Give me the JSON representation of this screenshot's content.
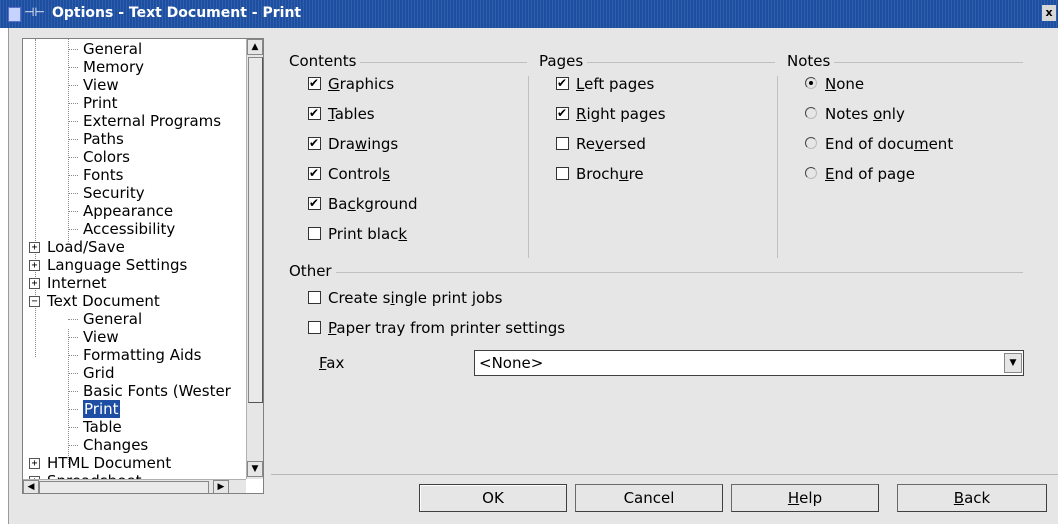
{
  "window": {
    "title": "Options - Text Document - Print",
    "title_icon": "window-pin-icon",
    "close": "x"
  },
  "tree": {
    "rows": [
      {
        "label": "General",
        "level": 2
      },
      {
        "label": "Memory",
        "level": 2
      },
      {
        "label": "View",
        "level": 2
      },
      {
        "label": "Print",
        "level": 2
      },
      {
        "label": "External Programs",
        "level": 2
      },
      {
        "label": "Paths",
        "level": 2
      },
      {
        "label": "Colors",
        "level": 2
      },
      {
        "label": "Fonts",
        "level": 2
      },
      {
        "label": "Security",
        "level": 2
      },
      {
        "label": "Appearance",
        "level": 2
      },
      {
        "label": "Accessibility",
        "level": 2
      },
      {
        "label": "Load/Save",
        "level": 1,
        "expander": "+"
      },
      {
        "label": "Language Settings",
        "level": 1,
        "expander": "+"
      },
      {
        "label": "Internet",
        "level": 1,
        "expander": "+"
      },
      {
        "label": "Text Document",
        "level": 1,
        "expander": "-"
      },
      {
        "label": "General",
        "level": 2
      },
      {
        "label": "View",
        "level": 2
      },
      {
        "label": "Formatting Aids",
        "level": 2
      },
      {
        "label": "Grid",
        "level": 2
      },
      {
        "label": "Basic Fonts (Wester",
        "level": 2
      },
      {
        "label": "Print",
        "level": 2,
        "selected": true
      },
      {
        "label": "Table",
        "level": 2
      },
      {
        "label": "Changes",
        "level": 2
      },
      {
        "label": "HTML Document",
        "level": 1,
        "expander": "+"
      },
      {
        "label": "Spreadsheet",
        "level": 1,
        "expander": "+"
      }
    ]
  },
  "contents": {
    "label": "Contents",
    "items": [
      {
        "pre": "",
        "key": "G",
        "post": "raphics",
        "checked": true
      },
      {
        "pre": "",
        "key": "T",
        "post": "ables",
        "checked": true
      },
      {
        "pre": "Dra",
        "key": "w",
        "post": "ings",
        "checked": true
      },
      {
        "pre": "Control",
        "key": "s",
        "post": "",
        "checked": true
      },
      {
        "pre": "Ba",
        "key": "c",
        "post": "kground",
        "checked": true
      },
      {
        "pre": "Print blac",
        "key": "k",
        "post": "",
        "checked": false
      }
    ]
  },
  "pages": {
    "label": "Pages",
    "items": [
      {
        "pre": "",
        "key": "L",
        "post": "eft pages",
        "checked": true
      },
      {
        "pre": "",
        "key": "R",
        "post": "ight pages",
        "checked": true
      },
      {
        "pre": "Re",
        "key": "v",
        "post": "ersed",
        "checked": false
      },
      {
        "pre": "Broch",
        "key": "u",
        "post": "re",
        "checked": false
      }
    ]
  },
  "notes": {
    "label": "Notes",
    "items": [
      {
        "pre": "",
        "key": "N",
        "post": "one",
        "checked": true
      },
      {
        "pre": "Notes ",
        "key": "o",
        "post": "nly",
        "checked": false
      },
      {
        "pre": "End of docu",
        "key": "m",
        "post": "ent",
        "checked": false
      },
      {
        "pre": "",
        "key": "E",
        "post": "nd of page",
        "checked": false
      }
    ]
  },
  "other": {
    "label": "Other",
    "items": [
      {
        "pre": "Create s",
        "key": "i",
        "post": "ngle print jobs",
        "checked": false
      },
      {
        "pre": "",
        "key": "P",
        "post": "aper tray from printer settings",
        "checked": false
      }
    ],
    "fax": {
      "pre": "",
      "key": "F",
      "post": "ax",
      "value": "<None>"
    }
  },
  "buttons": {
    "ok": {
      "pre": "OK",
      "key": "",
      "post": ""
    },
    "cancel": {
      "pre": "Cancel",
      "key": "",
      "post": ""
    },
    "help": {
      "pre": "",
      "key": "H",
      "post": "elp"
    },
    "back": {
      "pre": "",
      "key": "B",
      "post": "ack"
    }
  }
}
